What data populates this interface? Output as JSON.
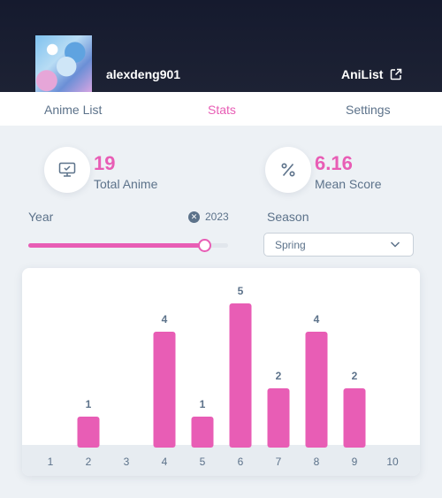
{
  "header": {
    "username": "alexdeng901",
    "link_label": "AniList"
  },
  "nav": {
    "tabs": [
      {
        "label": "Anime List",
        "active": false
      },
      {
        "label": "Stats",
        "active": true
      },
      {
        "label": "Settings",
        "active": false
      }
    ]
  },
  "stats": {
    "total": {
      "value": "19",
      "label": "Total Anime",
      "icon": "monitor-check-icon"
    },
    "mean": {
      "value": "6.16",
      "label": "Mean Score",
      "icon": "percent-icon"
    }
  },
  "filters": {
    "year_label": "Year",
    "year_value": "2023",
    "year_slider_fraction": 0.88,
    "season_label": "Season",
    "season_value": "Spring"
  },
  "colors": {
    "accent": "#e85db5",
    "text": "#5c728a",
    "header_bg": "#1a1f31",
    "axis_bg": "#e7ecf1"
  },
  "chart_data": {
    "type": "bar",
    "categories": [
      "1",
      "2",
      "3",
      "4",
      "5",
      "6",
      "7",
      "8",
      "9",
      "10"
    ],
    "values": [
      0,
      1,
      0,
      4,
      1,
      5,
      2,
      4,
      2,
      0
    ],
    "ylim": [
      0,
      5
    ],
    "grid": false
  }
}
